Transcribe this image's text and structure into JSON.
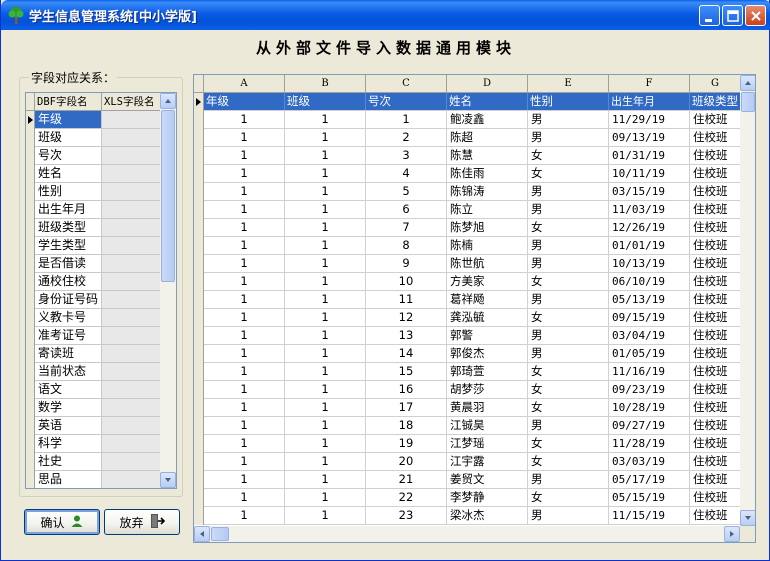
{
  "window": {
    "title": "学生信息管理系统[中小学版]"
  },
  "heading": "从外部文件导入数据通用模块",
  "field_map": {
    "group_label": "字段对应关系：",
    "col_dbf": "DBF字段名",
    "col_xls": "XLS字段名",
    "fields": [
      "年级",
      "班级",
      "号次",
      "姓名",
      "性别",
      "出生年月",
      "班级类型",
      "学生类型",
      "是否借读",
      "通校住校",
      "身份证号码",
      "义教卡号",
      "准考证号",
      "寄读班",
      "当前状态",
      "语文",
      "数学",
      "英语",
      "科学",
      "社史",
      "思品"
    ],
    "selected_index": 0
  },
  "buttons": {
    "ok": "确认",
    "cancel": "放弃"
  },
  "sheet": {
    "columns": [
      "A",
      "B",
      "C",
      "D",
      "E",
      "F",
      "G"
    ],
    "header_row": [
      "年级",
      "班级",
      "号次",
      "姓名",
      "性别",
      "出生年月",
      "班级类型"
    ],
    "rows": [
      [
        "1",
        "1",
        "1",
        "鲍凌鑫",
        "男",
        "11/29/19",
        "住校班"
      ],
      [
        "1",
        "1",
        "2",
        "陈超",
        "男",
        "09/13/19",
        "住校班"
      ],
      [
        "1",
        "1",
        "3",
        "陈慧",
        "女",
        "01/31/19",
        "住校班"
      ],
      [
        "1",
        "1",
        "4",
        "陈佳雨",
        "女",
        "10/11/19",
        "住校班"
      ],
      [
        "1",
        "1",
        "5",
        "陈锦涛",
        "男",
        "03/15/19",
        "住校班"
      ],
      [
        "1",
        "1",
        "6",
        "陈立",
        "男",
        "11/03/19",
        "住校班"
      ],
      [
        "1",
        "1",
        "7",
        "陈梦旭",
        "女",
        "12/26/19",
        "住校班"
      ],
      [
        "1",
        "1",
        "8",
        "陈楠",
        "男",
        "01/01/19",
        "住校班"
      ],
      [
        "1",
        "1",
        "9",
        "陈世航",
        "男",
        "10/13/19",
        "住校班"
      ],
      [
        "1",
        "1",
        "10",
        "方美家",
        "女",
        "06/10/19",
        "住校班"
      ],
      [
        "1",
        "1",
        "11",
        "葛祥飏",
        "男",
        "05/13/19",
        "住校班"
      ],
      [
        "1",
        "1",
        "12",
        "龚泓毓",
        "女",
        "09/15/19",
        "住校班"
      ],
      [
        "1",
        "1",
        "13",
        "郭警",
        "男",
        "03/04/19",
        "住校班"
      ],
      [
        "1",
        "1",
        "14",
        "郭俊杰",
        "男",
        "01/05/19",
        "住校班"
      ],
      [
        "1",
        "1",
        "15",
        "郭琦萱",
        "女",
        "11/16/19",
        "住校班"
      ],
      [
        "1",
        "1",
        "16",
        "胡梦莎",
        "女",
        "09/23/19",
        "住校班"
      ],
      [
        "1",
        "1",
        "17",
        "黄晨羽",
        "女",
        "10/28/19",
        "住校班"
      ],
      [
        "1",
        "1",
        "18",
        "江铖昊",
        "男",
        "09/27/19",
        "住校班"
      ],
      [
        "1",
        "1",
        "19",
        "江梦瑶",
        "女",
        "11/28/19",
        "住校班"
      ],
      [
        "1",
        "1",
        "20",
        "江宇露",
        "女",
        "03/03/19",
        "住校班"
      ],
      [
        "1",
        "1",
        "21",
        "姜贸文",
        "男",
        "05/17/19",
        "住校班"
      ],
      [
        "1",
        "1",
        "22",
        "李梦静",
        "女",
        "05/15/19",
        "住校班"
      ],
      [
        "1",
        "1",
        "23",
        "梁冰杰",
        "男",
        "11/15/19",
        "住校班"
      ]
    ]
  },
  "icons": {
    "app": "tree-icon",
    "ok": "user-icon",
    "cancel": "exit-door-icon"
  },
  "colors": {
    "selection": "#316ac5",
    "titlebar": "#0a5ce6"
  }
}
